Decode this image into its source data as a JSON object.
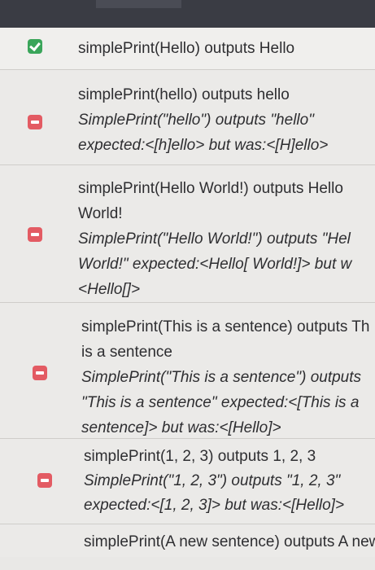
{
  "tests": [
    {
      "status": "pass",
      "status_icon": "check-icon",
      "title_lines": [
        "simplePrint(Hello) outputs Hello"
      ],
      "message_lines": []
    },
    {
      "status": "fail",
      "status_icon": "minus-icon",
      "title_lines": [
        "simplePrint(hello) outputs hello"
      ],
      "message_lines": [
        "SimplePrint(\"hello\") outputs \"hello\"",
        "expected:<[h]ello> but was:<[H]ello>"
      ]
    },
    {
      "status": "fail",
      "status_icon": "minus-icon",
      "title_lines": [
        "simplePrint(Hello World!) outputs Hello",
        "World!"
      ],
      "message_lines": [
        "SimplePrint(\"Hello World!\") outputs \"Hel",
        "World!\" expected:<Hello[ World!]> but w",
        "<Hello[]>"
      ]
    },
    {
      "status": "fail",
      "status_icon": "minus-icon",
      "title_lines": [
        "simplePrint(This is a sentence) outputs Th",
        "is a sentence"
      ],
      "message_lines": [
        "SimplePrint(\"This is a sentence\") outputs",
        "\"This is a sentence\" expected:<[This is a",
        "sentence]> but was:<[Hello]>"
      ]
    },
    {
      "status": "fail",
      "status_icon": "minus-icon",
      "title_lines": [
        "simplePrint(1, 2, 3) outputs 1, 2, 3"
      ],
      "message_lines": [
        "SimplePrint(\"1, 2, 3\") outputs \"1, 2, 3\"",
        "expected:<[1, 2, 3]> but was:<[Hello]>"
      ]
    },
    {
      "status": "partial",
      "status_icon": "",
      "title_lines": [
        "simplePrint(A new sentence) outputs A new"
      ],
      "message_lines": []
    }
  ],
  "colors": {
    "pass": "#3aa55a",
    "fail": "#e35b63",
    "text": "#2e2e31",
    "header": "#3a3c44"
  }
}
